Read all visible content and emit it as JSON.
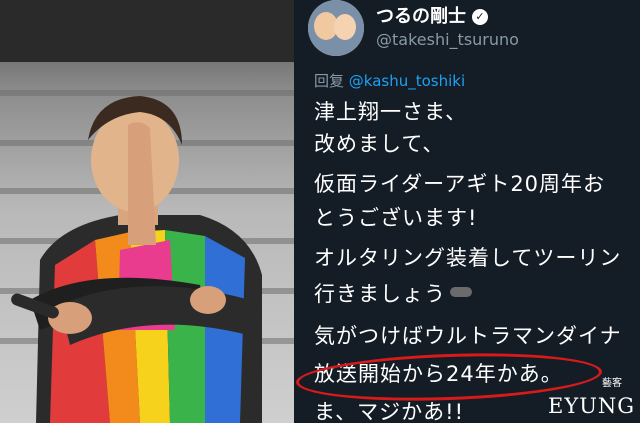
{
  "tweet": {
    "display_name": "つるの剛士",
    "handle": "@takeshi_tsuruno",
    "reply_prefix": "回复",
    "reply_to": "@kashu_toshiki",
    "lines": [
      "津上翔一さま、",
      "改めまして、",
      "仮面ライダーアギト20周年お",
      "とうございます!",
      "オルタリング装着してツーリン",
      "行きましょう",
      "気がつけばウルトラマンダイナ",
      "放送開始から24年かあ。",
      "ま、マジかあ!!"
    ]
  },
  "watermark": {
    "text": "EYUNG",
    "small": "藝客"
  },
  "colors": {
    "tweet_bg": "#141d26",
    "mention": "#1da1f2",
    "highlight_circle": "#d81a1a"
  },
  "icons": {
    "verified": "verified-badge-icon",
    "emoji": "motorcycle-emoji-icon"
  }
}
